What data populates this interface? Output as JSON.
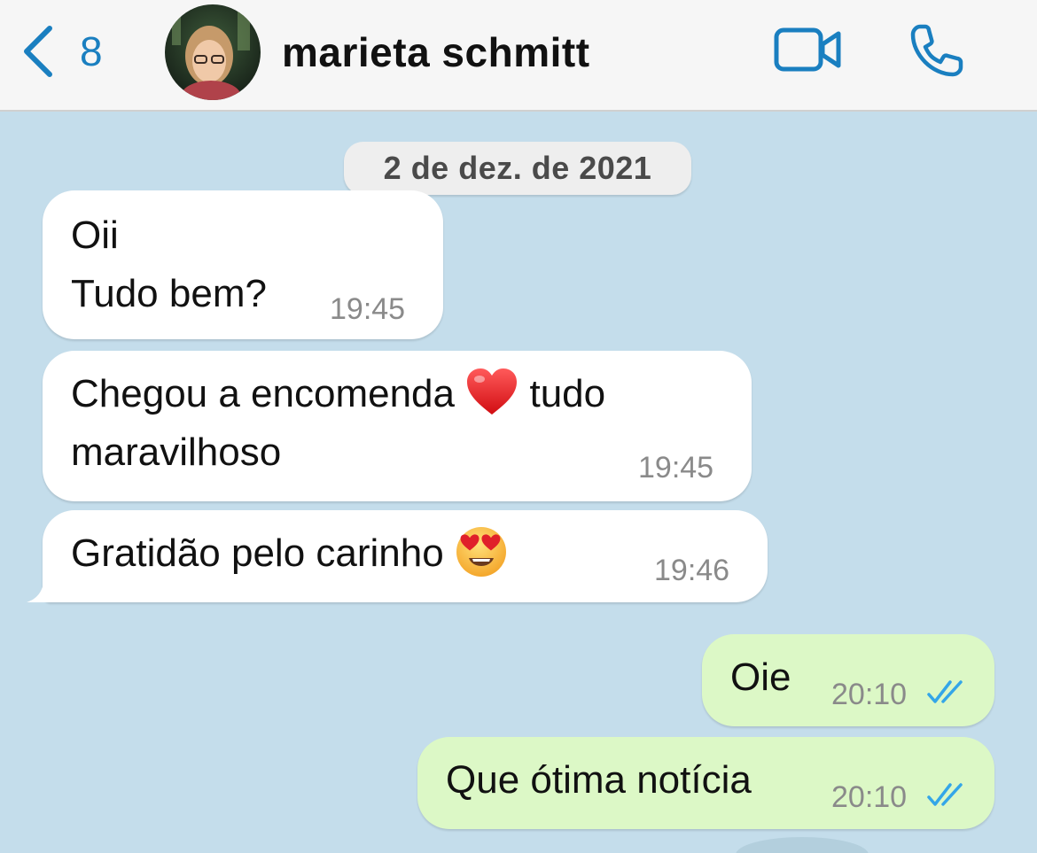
{
  "header": {
    "back_count": "8",
    "contact_name": "marieta schmitt",
    "accent_color": "#1a7fc0"
  },
  "chat": {
    "date_label": "2 de dez. de 2021",
    "messages": [
      {
        "direction": "incoming",
        "lines": [
          "Oii",
          "Tudo bem?"
        ],
        "time": "19:45"
      },
      {
        "direction": "incoming",
        "line1_before_emoji": "Chegou a encomenda",
        "emoji": "red-heart",
        "line1_after_emoji": "tudo",
        "line2": "maravilhoso",
        "time": "19:45"
      },
      {
        "direction": "incoming",
        "text": "Gratidão pelo carinho",
        "emoji": "heart-eyes-face",
        "time": "19:46"
      },
      {
        "direction": "outgoing",
        "text": "Oie",
        "time": "20:10",
        "status": "read"
      },
      {
        "direction": "outgoing",
        "text": "Que ótima notícia",
        "time": "20:10",
        "status": "read"
      }
    ]
  },
  "colors": {
    "chat_background": "#c4ddeb",
    "incoming_bubble": "#ffffff",
    "outgoing_bubble": "#dcf8c6",
    "read_ticks": "#34a6e8"
  }
}
